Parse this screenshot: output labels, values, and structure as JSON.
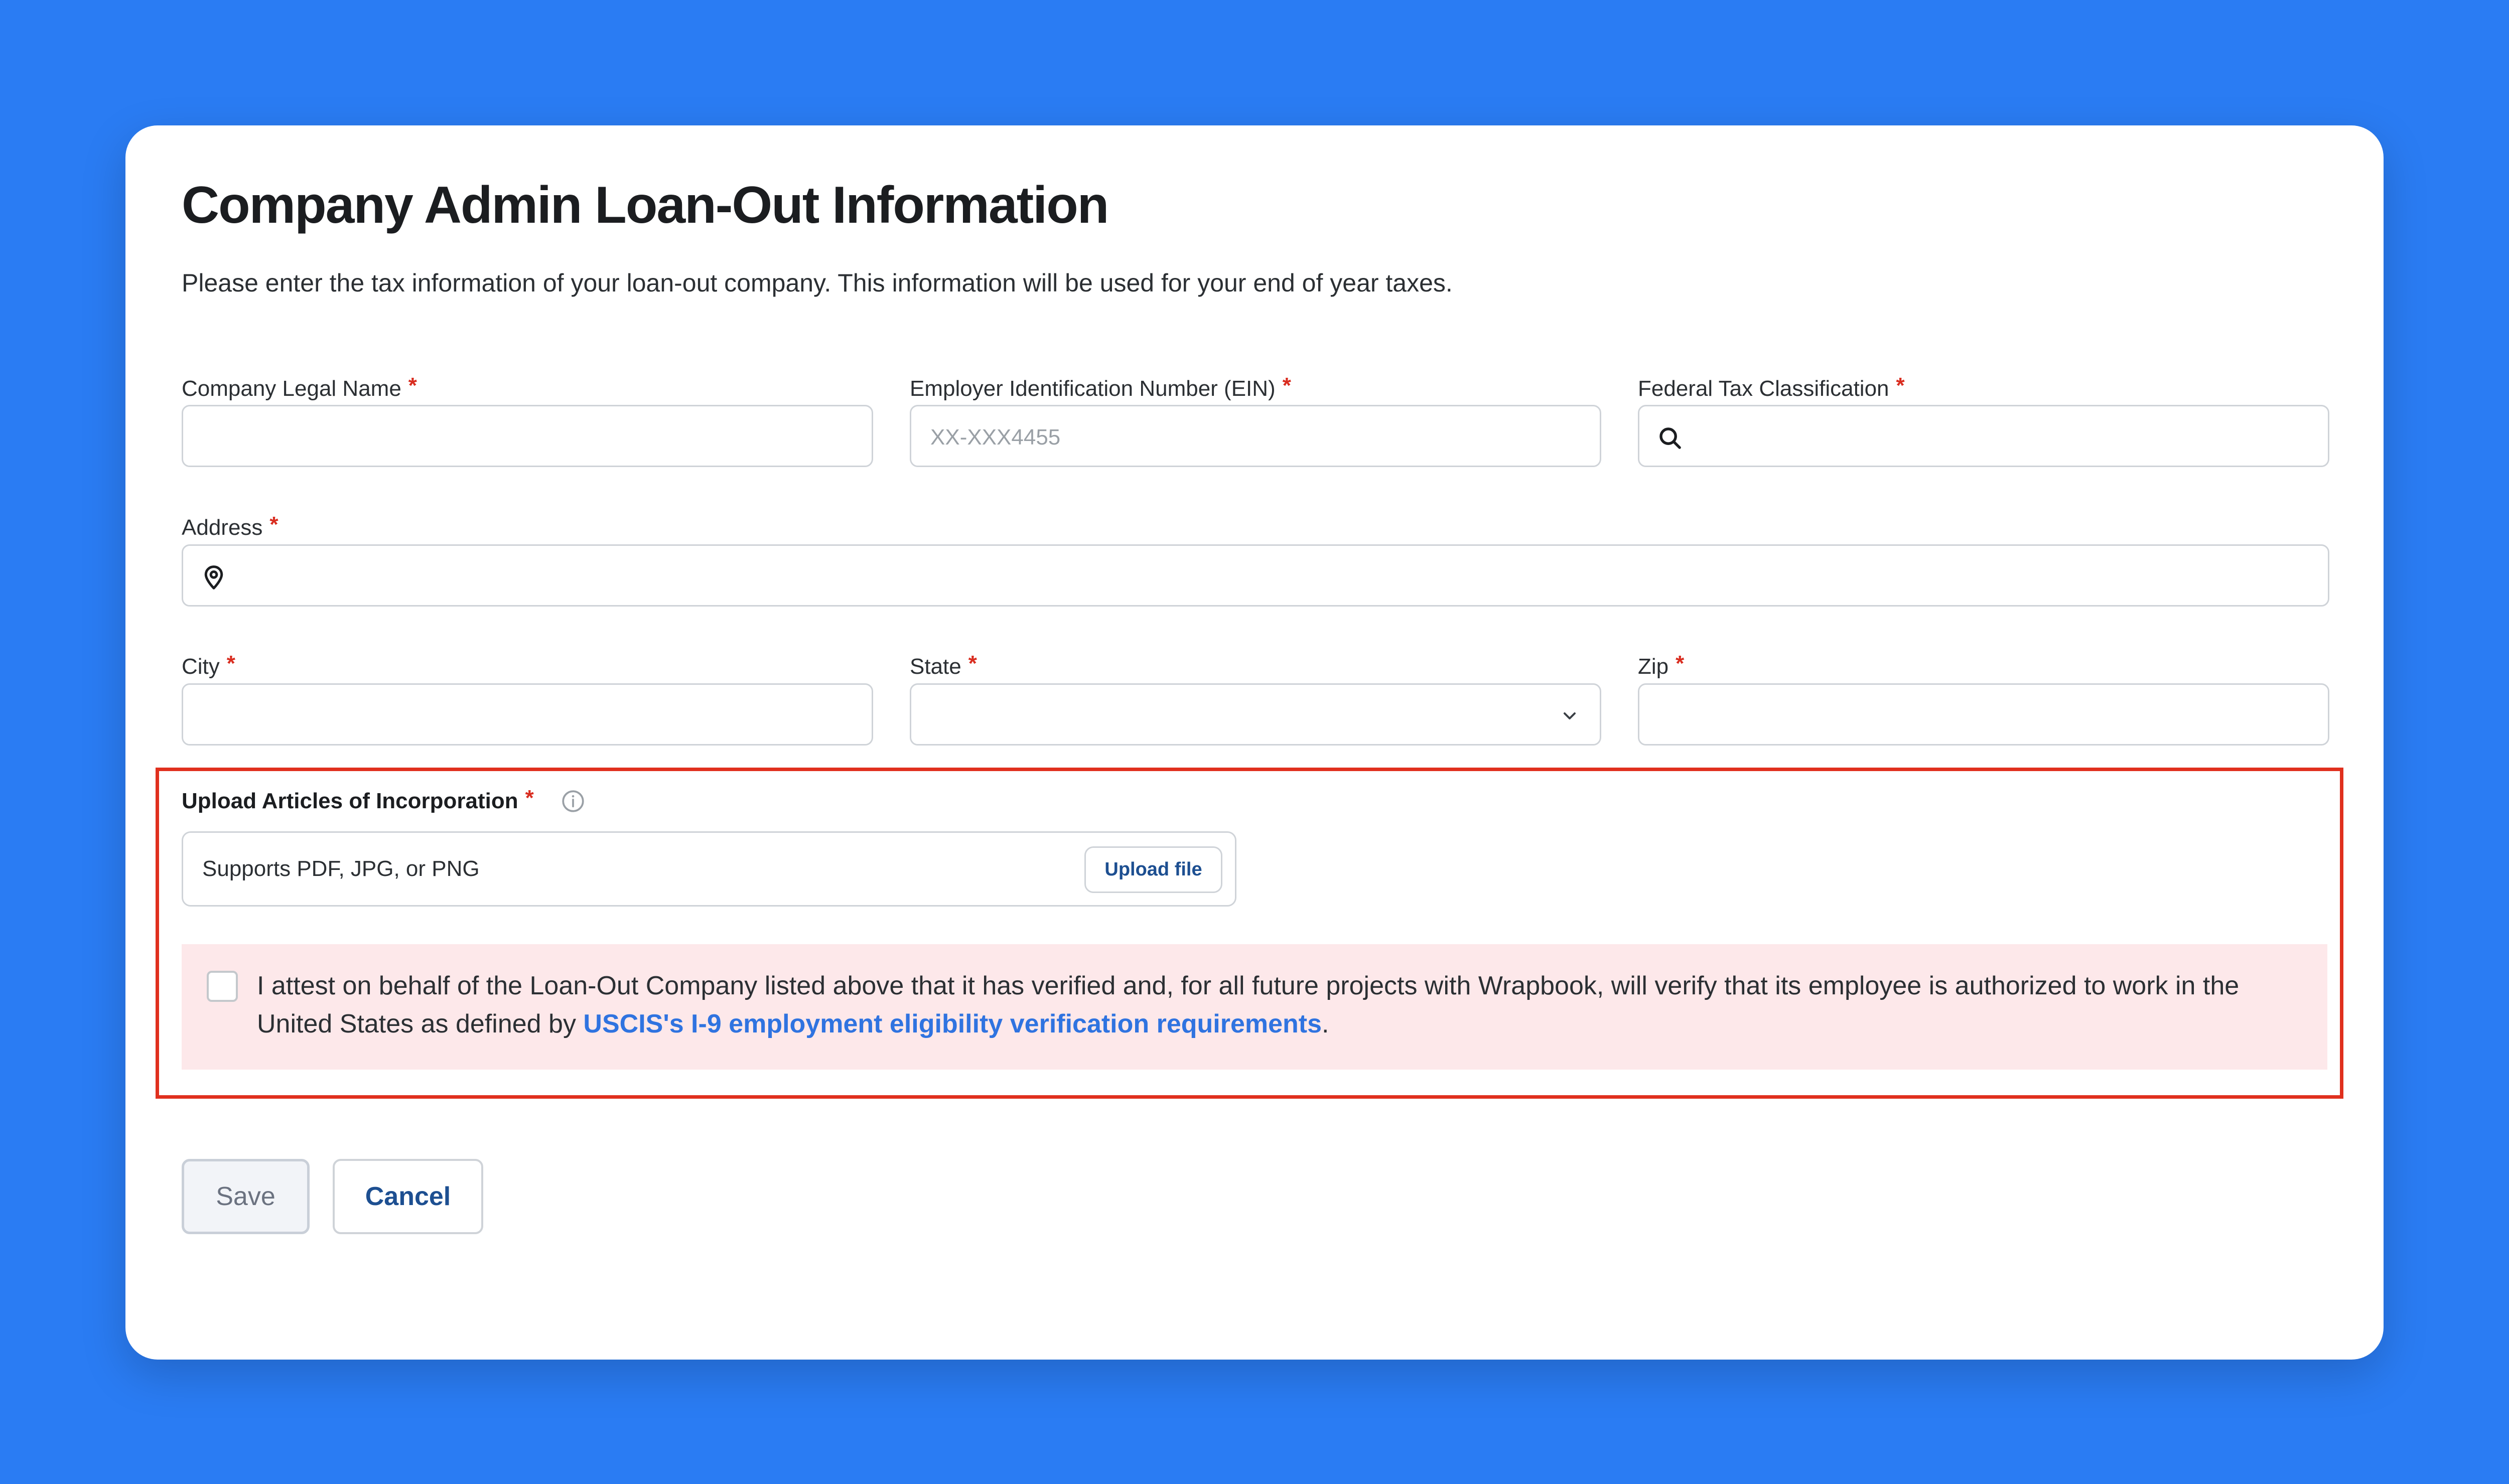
{
  "form": {
    "title": "Company Admin Loan-Out Information",
    "subtitle": "Please enter the tax information of your loan-out company. This information will be used for your end of year taxes.",
    "required_marker": "*",
    "fields": {
      "company_legal_name": {
        "label": "Company Legal Name",
        "value": "",
        "placeholder": ""
      },
      "ein": {
        "label": "Employer Identification Number (EIN)",
        "value": "",
        "placeholder": "XX-XXX4455"
      },
      "federal_tax_classification": {
        "label": "Federal Tax Classification",
        "value": "",
        "icon": "search-icon"
      },
      "address": {
        "label": "Address",
        "value": "",
        "icon": "location-pin-icon"
      },
      "city": {
        "label": "City",
        "value": ""
      },
      "state": {
        "label": "State",
        "selected": "",
        "icon": "chevron-down-icon"
      },
      "zip": {
        "label": "Zip",
        "value": ""
      }
    },
    "upload": {
      "label": "Upload Articles of Incorporation",
      "info_icon": "info-icon",
      "hint": "Supports PDF, JPG, or PNG",
      "button_label": "Upload file"
    },
    "attestation": {
      "checked": false,
      "text_before": "I attest on behalf of the Loan-Out Company listed above that it has verified and, for all future projects with Wrapbook, will verify that its employee is authorized to work in the United States as defined by ",
      "link_text": "USCIS's I-9 employment eligibility verification requirements",
      "text_after": "."
    },
    "actions": {
      "save_label": "Save",
      "cancel_label": "Cancel"
    }
  },
  "colors": {
    "background": "#2a7cf3",
    "required": "#d92d20",
    "highlight_border": "#e0301e",
    "attest_background": "#fde8ea",
    "link": "#2f73e0",
    "primary_text": "#1d4f91"
  }
}
